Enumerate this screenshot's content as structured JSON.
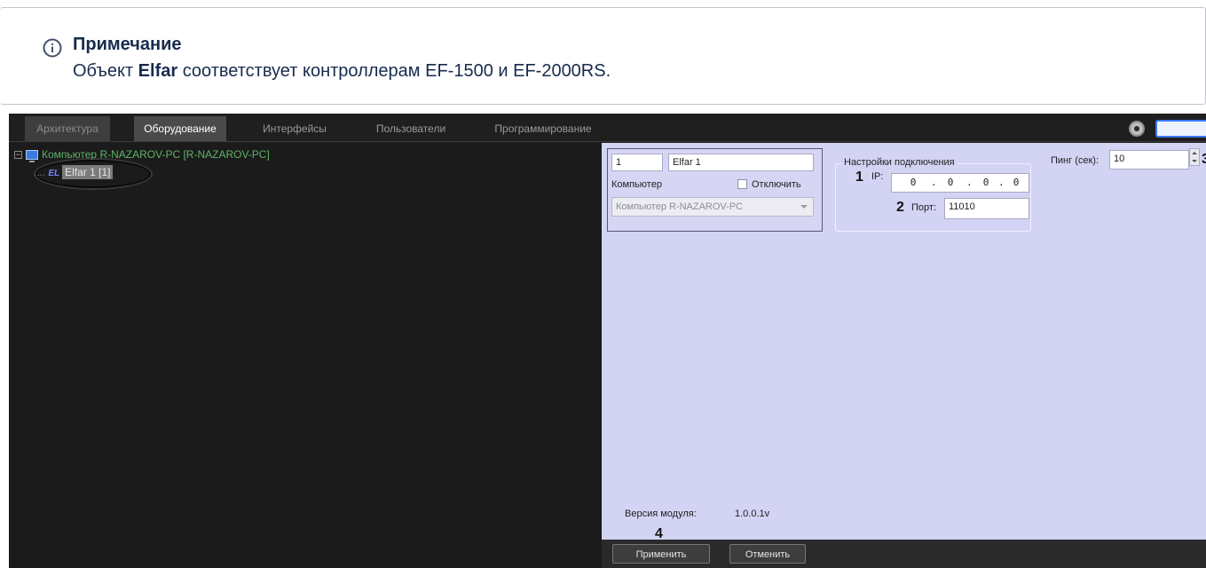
{
  "note": {
    "title": "Примечание",
    "text_prefix": "Объект ",
    "text_bold": "Elfar",
    "text_suffix": " соответствует контроллерам EF-1500 и EF-2000RS."
  },
  "tabs": [
    "Архитектура",
    "Оборудование",
    "Интерфейсы",
    "Пользователи",
    "Программирование"
  ],
  "active_tab": "Оборудование",
  "tree": {
    "root": "Компьютер R-NAZAROV-PC [R-NAZAROV-PC]",
    "expander": "−",
    "child_dots": "....",
    "child_icon": "EL",
    "child": "Elfar 1 [1]"
  },
  "panel": {
    "id": "1",
    "name": "Elfar 1",
    "computer_label": "Компьютер",
    "disable_label": "Отключить",
    "computer_value": "Компьютер R-NAZAROV-PC",
    "conn_title": "Настройки подключения",
    "ip_label": "IP:",
    "ip": [
      "0",
      "0",
      "0",
      "0"
    ],
    "ip_sep": ".",
    "port_label": "Порт:",
    "port": "11010",
    "ping_label": "Пинг (сек):",
    "ping": "10",
    "version_label": "Версия модуля:",
    "version": "1.0.0.1v",
    "apply": "Применить",
    "cancel": "Отменить"
  },
  "callouts": [
    "1",
    "2",
    "3",
    "4"
  ],
  "colors": {
    "tree_text": "#5fb36a",
    "panel_bg": "#d3d3f4",
    "accent": "#3a79ff"
  }
}
